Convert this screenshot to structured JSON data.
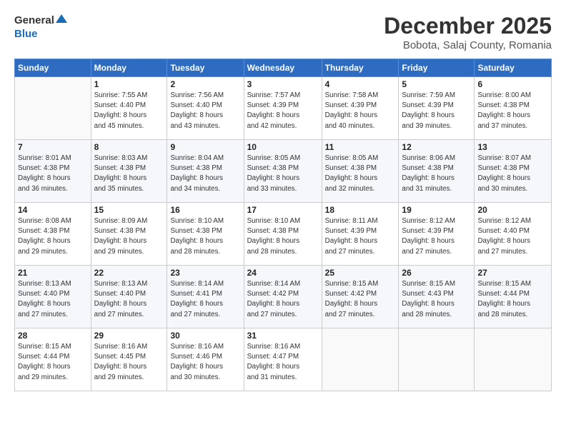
{
  "logo": {
    "general": "General",
    "blue": "Blue"
  },
  "title": "December 2025",
  "subtitle": "Bobota, Salaj County, Romania",
  "header": {
    "days": [
      "Sunday",
      "Monday",
      "Tuesday",
      "Wednesday",
      "Thursday",
      "Friday",
      "Saturday"
    ]
  },
  "weeks": [
    [
      {
        "day": "",
        "info": ""
      },
      {
        "day": "1",
        "info": "Sunrise: 7:55 AM\nSunset: 4:40 PM\nDaylight: 8 hours\nand 45 minutes."
      },
      {
        "day": "2",
        "info": "Sunrise: 7:56 AM\nSunset: 4:40 PM\nDaylight: 8 hours\nand 43 minutes."
      },
      {
        "day": "3",
        "info": "Sunrise: 7:57 AM\nSunset: 4:39 PM\nDaylight: 8 hours\nand 42 minutes."
      },
      {
        "day": "4",
        "info": "Sunrise: 7:58 AM\nSunset: 4:39 PM\nDaylight: 8 hours\nand 40 minutes."
      },
      {
        "day": "5",
        "info": "Sunrise: 7:59 AM\nSunset: 4:39 PM\nDaylight: 8 hours\nand 39 minutes."
      },
      {
        "day": "6",
        "info": "Sunrise: 8:00 AM\nSunset: 4:38 PM\nDaylight: 8 hours\nand 37 minutes."
      }
    ],
    [
      {
        "day": "7",
        "info": "Sunrise: 8:01 AM\nSunset: 4:38 PM\nDaylight: 8 hours\nand 36 minutes."
      },
      {
        "day": "8",
        "info": "Sunrise: 8:03 AM\nSunset: 4:38 PM\nDaylight: 8 hours\nand 35 minutes."
      },
      {
        "day": "9",
        "info": "Sunrise: 8:04 AM\nSunset: 4:38 PM\nDaylight: 8 hours\nand 34 minutes."
      },
      {
        "day": "10",
        "info": "Sunrise: 8:05 AM\nSunset: 4:38 PM\nDaylight: 8 hours\nand 33 minutes."
      },
      {
        "day": "11",
        "info": "Sunrise: 8:05 AM\nSunset: 4:38 PM\nDaylight: 8 hours\nand 32 minutes."
      },
      {
        "day": "12",
        "info": "Sunrise: 8:06 AM\nSunset: 4:38 PM\nDaylight: 8 hours\nand 31 minutes."
      },
      {
        "day": "13",
        "info": "Sunrise: 8:07 AM\nSunset: 4:38 PM\nDaylight: 8 hours\nand 30 minutes."
      }
    ],
    [
      {
        "day": "14",
        "info": "Sunrise: 8:08 AM\nSunset: 4:38 PM\nDaylight: 8 hours\nand 29 minutes."
      },
      {
        "day": "15",
        "info": "Sunrise: 8:09 AM\nSunset: 4:38 PM\nDaylight: 8 hours\nand 29 minutes."
      },
      {
        "day": "16",
        "info": "Sunrise: 8:10 AM\nSunset: 4:38 PM\nDaylight: 8 hours\nand 28 minutes."
      },
      {
        "day": "17",
        "info": "Sunrise: 8:10 AM\nSunset: 4:38 PM\nDaylight: 8 hours\nand 28 minutes."
      },
      {
        "day": "18",
        "info": "Sunrise: 8:11 AM\nSunset: 4:39 PM\nDaylight: 8 hours\nand 27 minutes."
      },
      {
        "day": "19",
        "info": "Sunrise: 8:12 AM\nSunset: 4:39 PM\nDaylight: 8 hours\nand 27 minutes."
      },
      {
        "day": "20",
        "info": "Sunrise: 8:12 AM\nSunset: 4:40 PM\nDaylight: 8 hours\nand 27 minutes."
      }
    ],
    [
      {
        "day": "21",
        "info": "Sunrise: 8:13 AM\nSunset: 4:40 PM\nDaylight: 8 hours\nand 27 minutes."
      },
      {
        "day": "22",
        "info": "Sunrise: 8:13 AM\nSunset: 4:40 PM\nDaylight: 8 hours\nand 27 minutes."
      },
      {
        "day": "23",
        "info": "Sunrise: 8:14 AM\nSunset: 4:41 PM\nDaylight: 8 hours\nand 27 minutes."
      },
      {
        "day": "24",
        "info": "Sunrise: 8:14 AM\nSunset: 4:42 PM\nDaylight: 8 hours\nand 27 minutes."
      },
      {
        "day": "25",
        "info": "Sunrise: 8:15 AM\nSunset: 4:42 PM\nDaylight: 8 hours\nand 27 minutes."
      },
      {
        "day": "26",
        "info": "Sunrise: 8:15 AM\nSunset: 4:43 PM\nDaylight: 8 hours\nand 28 minutes."
      },
      {
        "day": "27",
        "info": "Sunrise: 8:15 AM\nSunset: 4:44 PM\nDaylight: 8 hours\nand 28 minutes."
      }
    ],
    [
      {
        "day": "28",
        "info": "Sunrise: 8:15 AM\nSunset: 4:44 PM\nDaylight: 8 hours\nand 29 minutes."
      },
      {
        "day": "29",
        "info": "Sunrise: 8:16 AM\nSunset: 4:45 PM\nDaylight: 8 hours\nand 29 minutes."
      },
      {
        "day": "30",
        "info": "Sunrise: 8:16 AM\nSunset: 4:46 PM\nDaylight: 8 hours\nand 30 minutes."
      },
      {
        "day": "31",
        "info": "Sunrise: 8:16 AM\nSunset: 4:47 PM\nDaylight: 8 hours\nand 31 minutes."
      },
      {
        "day": "",
        "info": ""
      },
      {
        "day": "",
        "info": ""
      },
      {
        "day": "",
        "info": ""
      }
    ]
  ]
}
